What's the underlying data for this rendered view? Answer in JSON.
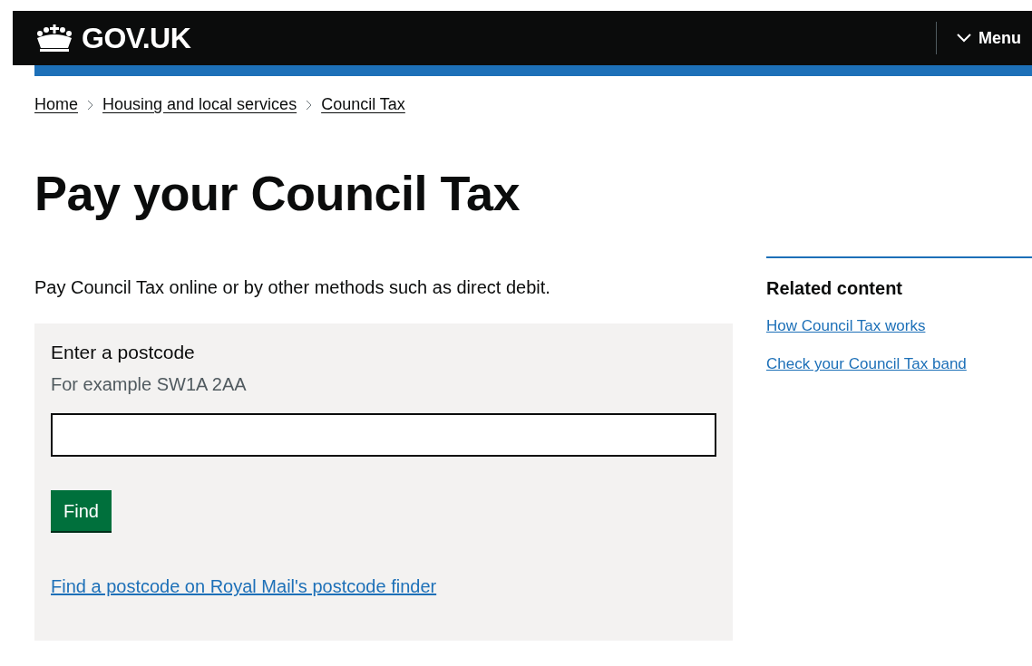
{
  "header": {
    "logo": "GOV.UK",
    "menu": "Menu"
  },
  "breadcrumbs": [
    "Home",
    "Housing and local services",
    "Council Tax"
  ],
  "title": "Pay your Council Tax",
  "lead": "Pay Council Tax online or by other methods such as direct debit.",
  "form": {
    "label": "Enter a postcode",
    "hint": "For example SW1A 2AA",
    "button": "Find",
    "link": "Find a postcode on Royal Mail's postcode finder"
  },
  "related": {
    "heading": "Related content",
    "links": [
      "How Council Tax works",
      "Check your Council Tax band"
    ]
  }
}
